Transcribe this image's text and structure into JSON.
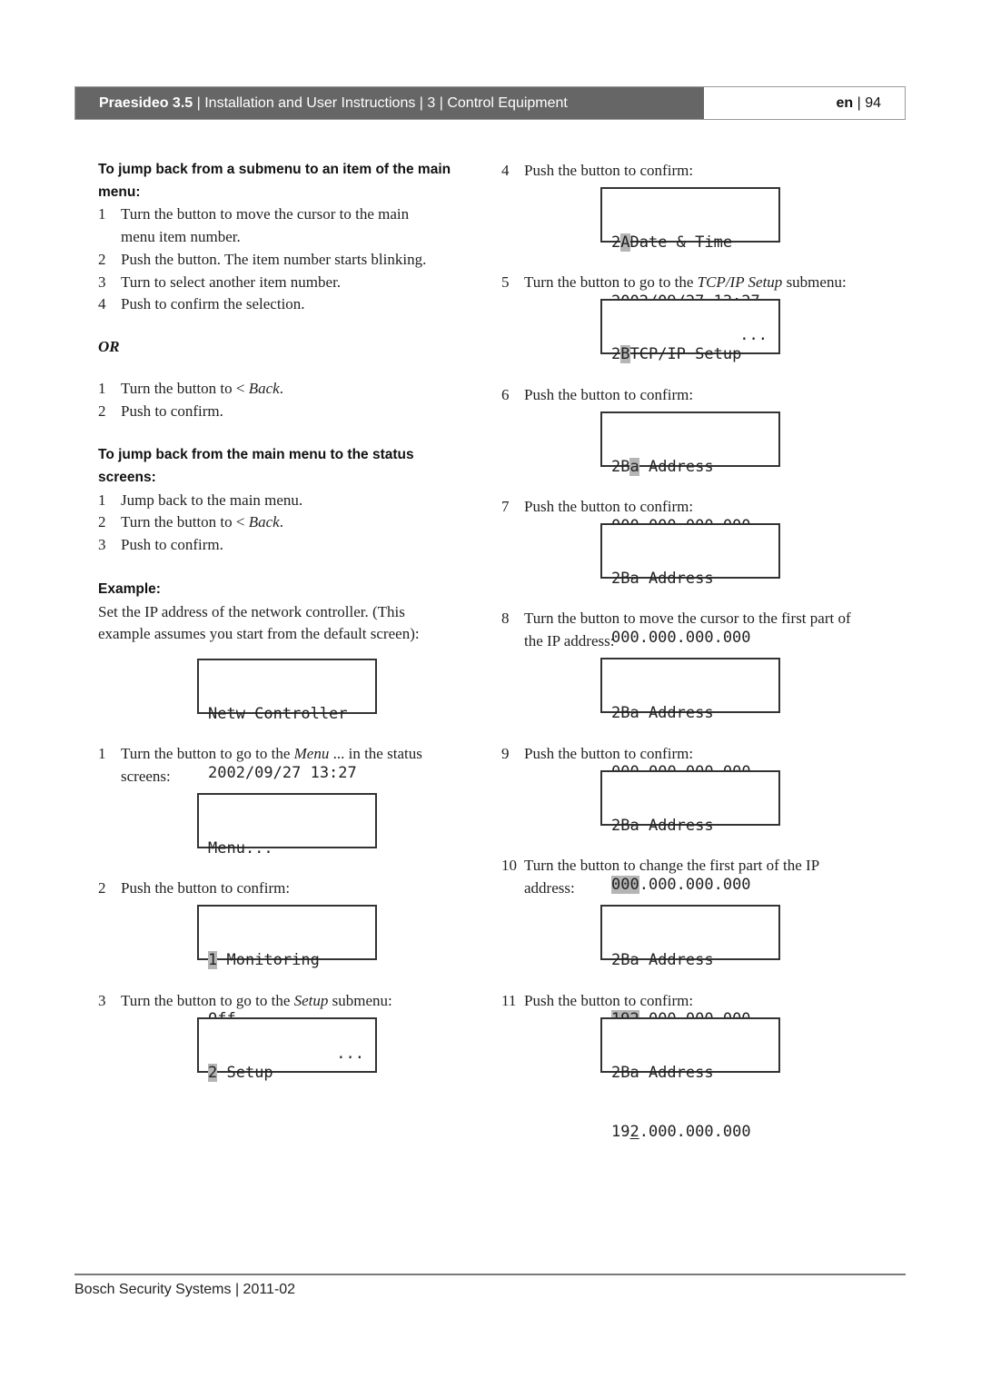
{
  "header": {
    "product": "Praesideo 3.5",
    "separator": " | ",
    "doc_title": "Installation and User Instructions",
    "chapter_num": "3",
    "chapter_title": "Control Equipment",
    "lang": "en",
    "page": "94"
  },
  "left": {
    "section1": {
      "heading_line1": "To jump back from a submenu to an item of the main",
      "heading_line2": "menu:",
      "steps": [
        {
          "num": "1",
          "line1": "Turn the button to move the cursor to the main",
          "line2": "menu item number."
        },
        {
          "num": "2",
          "line1": "Push the button. The item number starts blinking."
        },
        {
          "num": "3",
          "line1": "Turn to select another item number."
        },
        {
          "num": "4",
          "line1": "Push to confirm the selection."
        }
      ]
    },
    "or_label": "OR",
    "section2": {
      "steps": [
        {
          "num": "1",
          "prefix": "Turn the button to < ",
          "italic": "Back",
          "suffix": "."
        },
        {
          "num": "2",
          "text": "Push to confirm."
        }
      ]
    },
    "section3": {
      "heading_line1": "To jump back from the main menu to the status",
      "heading_line2": "screens:",
      "steps": [
        {
          "num": "1",
          "text": "Jump back to the main menu."
        },
        {
          "num": "2",
          "prefix": "Turn the button to < ",
          "italic": "Back",
          "suffix": "."
        },
        {
          "num": "3",
          "text": "Push to confirm."
        }
      ]
    },
    "example": {
      "heading": "Example:",
      "line1": "Set the IP address of the network controller. (This",
      "line2": "example assumes you start from the default screen):",
      "lcd_default": {
        "line1": "Netw Controller",
        "line2": "2002/09/27 13:27"
      },
      "steps": [
        {
          "num": "1",
          "prefix": "Turn the button to go to the ",
          "italic": "Menu",
          "suffix": " ... in the status",
          "line2": "screens:",
          "lcd": {
            "line1": "Menu...",
            "line2": ""
          }
        },
        {
          "num": "2",
          "text": "Push the button to confirm:",
          "lcd": {
            "hl": "1",
            "line1_rest": " Monitoring",
            "line2": "Off"
          }
        },
        {
          "num": "3",
          "prefix": "Turn the button to go to the ",
          "italic": "Setup",
          "suffix": " submenu:",
          "lcd": {
            "hl": "2",
            "line1_rest": " Setup",
            "line2_right": "..."
          }
        }
      ]
    }
  },
  "right": {
    "steps": [
      {
        "num": "4",
        "text": "Push the button to confirm:",
        "lcd": {
          "pre": "2",
          "hl": "A",
          "line1_rest": "Date & Time",
          "line2": "2002/09/27 13:27"
        }
      },
      {
        "num": "5",
        "prefix": "Turn the button to go to the ",
        "italic": "TCP/IP Setup",
        "suffix": " submenu:",
        "lcd": {
          "pre": "2",
          "hl": "B",
          "line1_rest": "TCP/IP Setup",
          "line2_right": "..."
        }
      },
      {
        "num": "6",
        "text": "Push the button to confirm:",
        "lcd": {
          "pre": "2B",
          "hl": "a",
          "line1_rest": " Address",
          "line2": "000.000.000.000"
        }
      },
      {
        "num": "7",
        "text": "Push the button to confirm:",
        "lcd": {
          "line1": "2Ba Address",
          "line2": "000.000.000.000"
        }
      },
      {
        "num": "8",
        "line1": "Turn the button to move the cursor to the first part of",
        "line2": "the IP address:",
        "lcd": {
          "line1": "2Ba Address",
          "line2_pre": "00",
          "line2_ul": "0",
          "line2_rest": ".000.000.000"
        }
      },
      {
        "num": "9",
        "text": "Push the button to confirm:",
        "lcd": {
          "line1": "2Ba Address",
          "line2_hl": "000",
          "line2_rest": ".000.000.000"
        }
      },
      {
        "num": "10",
        "line1": "Turn the button to change the first part of the IP",
        "line2": "address:",
        "lcd": {
          "line1": "2Ba Address",
          "line2_hl": "192",
          "line2_rest": ".000.000.000"
        }
      },
      {
        "num": "11",
        "text": "Push the button to confirm:",
        "lcd": {
          "line1": "2Ba Address",
          "line2_pre": "19",
          "line2_ul": "2",
          "line2_rest": ".000.000.000"
        }
      }
    ]
  },
  "footer": {
    "company": "Bosch Security Systems",
    "separator": " | ",
    "date": "2011-02"
  }
}
